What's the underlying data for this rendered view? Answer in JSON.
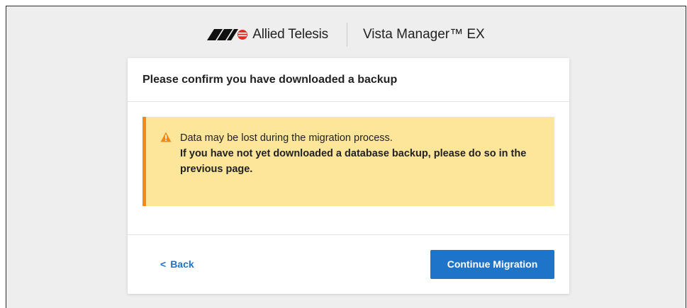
{
  "brand": {
    "company": "Allied Telesis",
    "product": "Vista Manager™ EX",
    "logo_icon": "allied-telesis-logo-icon",
    "colors": {
      "logo_mark": "#111111",
      "logo_accent": "#e32c2c"
    }
  },
  "dialog": {
    "title": "Please confirm you have downloaded a backup",
    "warning": {
      "icon": "warning-triangle-icon",
      "line1": "Data may be lost during the migration process.",
      "line2": "If you have not yet downloaded a database backup, please do so in the previous page.",
      "colors": {
        "background": "#fde599",
        "border": "#f28a1b"
      }
    },
    "footer": {
      "back_chevron": "<",
      "back_label": "Back",
      "continue_label": "Continue Migration",
      "colors": {
        "primary": "#1d74c9",
        "link": "#1e73c8"
      }
    }
  }
}
